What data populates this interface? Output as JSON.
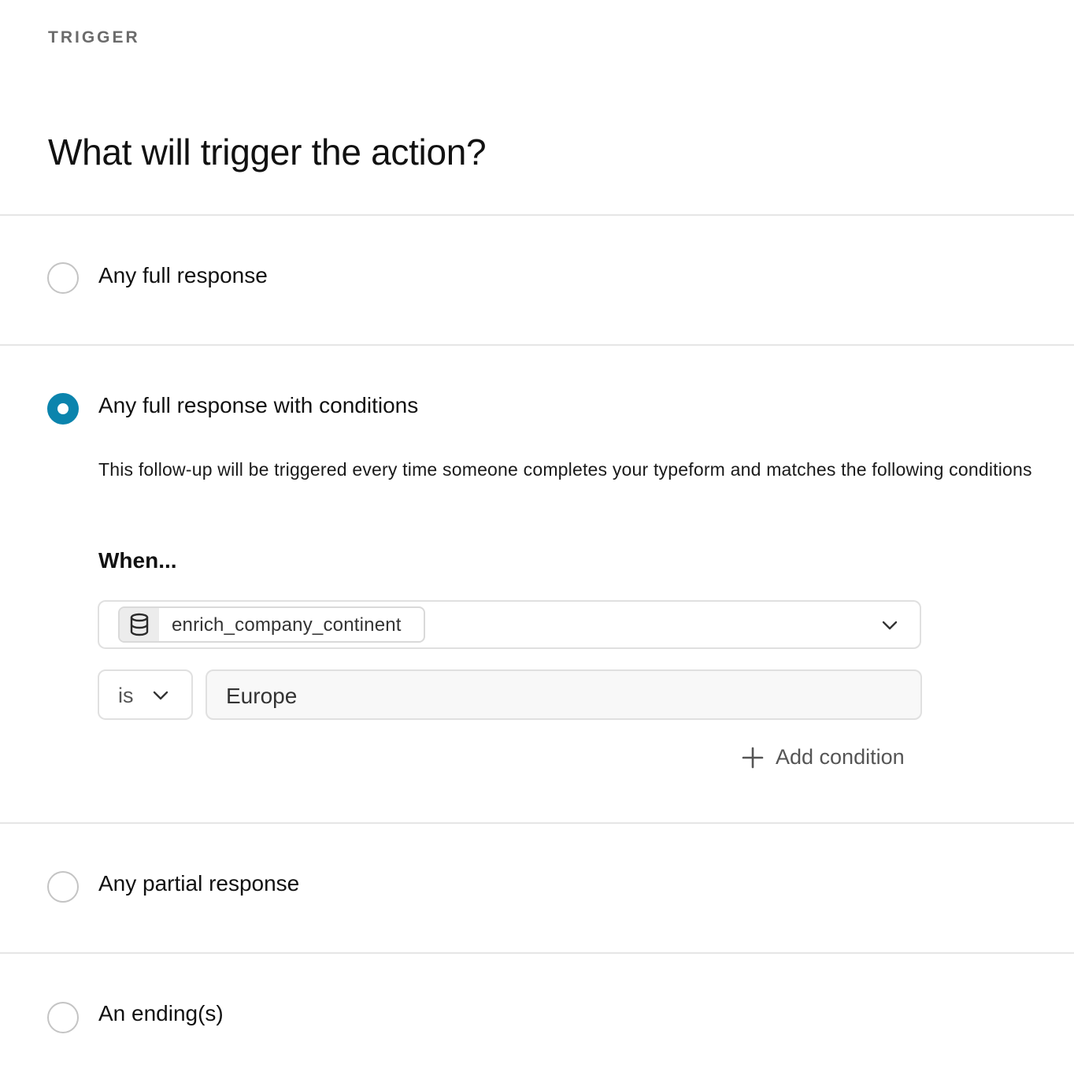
{
  "header": {
    "section_label": "TRIGGER",
    "title": "What will trigger the action?"
  },
  "options": [
    {
      "label": "Any full response",
      "selected": false
    },
    {
      "label": "Any full response with conditions",
      "selected": true
    },
    {
      "label": "Any partial response",
      "selected": false
    },
    {
      "label": "An ending(s)",
      "selected": false
    }
  ],
  "conditions": {
    "description": "This follow-up will be triggered every time someone completes your typeform and matches the following conditions",
    "when_label": "When...",
    "field": {
      "icon": "database-icon",
      "value": "enrich_company_continent"
    },
    "operator": {
      "value": "is"
    },
    "comparison_value": "Europe",
    "add_condition_label": "Add condition"
  },
  "colors": {
    "accent": "#0b84ad",
    "divider": "#e6e6e6",
    "muted_text": "#6b6b6b"
  }
}
